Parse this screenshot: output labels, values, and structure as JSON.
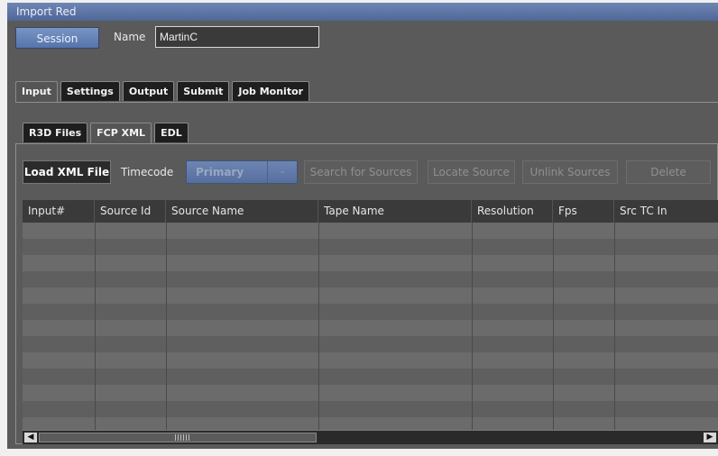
{
  "window": {
    "title": "Import Red"
  },
  "session": {
    "session_label": "Session",
    "name_label": "Name",
    "name_value": "MartinC"
  },
  "main_tabs": [
    {
      "label": "Input",
      "active": true
    },
    {
      "label": "Settings",
      "active": false
    },
    {
      "label": "Output",
      "active": false
    },
    {
      "label": "Submit",
      "active": false
    },
    {
      "label": "Job Monitor",
      "active": false
    }
  ],
  "sub_tabs": [
    {
      "label": "R3D Files",
      "active": false
    },
    {
      "label": "FCP XML",
      "active": true
    },
    {
      "label": "EDL",
      "active": false
    }
  ],
  "toolbar": {
    "load_xml": "Load XML File",
    "timecode_label": "Timecode",
    "timecode_value": "Primary",
    "search_sources": "Search for Sources",
    "locate_source": "Locate Source",
    "unlink_sources": "Unlink Sources",
    "delete": "Delete"
  },
  "table": {
    "columns": [
      "Input#",
      "Source Id",
      "Source Name",
      "Tape Name",
      "Resolution",
      "Fps",
      "Src TC In"
    ],
    "rows": []
  },
  "colors": {
    "title_bar": "#5d76a8",
    "panel": "#5a5a5a",
    "accent_blue": "#6481b6"
  },
  "icons": {
    "scroll_left": "left-arrow-icon",
    "scroll_right": "right-arrow-icon"
  }
}
